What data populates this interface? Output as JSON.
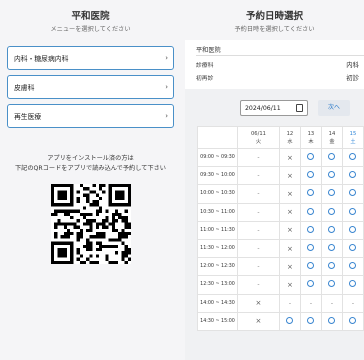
{
  "left": {
    "title": "平和医院",
    "subtitle": "メニューを選択してください",
    "menu": [
      {
        "label": "内科・糖尿病内科",
        "icon": "chevron-right-icon"
      },
      {
        "label": "皮膚科",
        "icon": "chevron-right-icon"
      },
      {
        "label": "再生医療",
        "icon": "chevron-right-icon"
      }
    ],
    "install_line1": "アプリをインストール済の方は",
    "install_line2": "下記のQRコードをアプリで読み込んで予約して下さい"
  },
  "right": {
    "title": "予約日時選択",
    "subtitle": "予約日時を選択してください",
    "clinic": "平和医院",
    "dept_label": "診療科",
    "dept_value": "内科",
    "visit_label": "初再診",
    "visit_value": "初診",
    "date_value": "2024/06/11",
    "next_label": "次へ",
    "days": [
      {
        "date": "06/11",
        "dow": "火"
      },
      {
        "date": "12",
        "dow": "水"
      },
      {
        "date": "13",
        "dow": "木"
      },
      {
        "date": "14",
        "dow": "金"
      },
      {
        "date": "15",
        "dow": "土"
      }
    ],
    "slots": [
      {
        "time": "09:00 ~ 09:30",
        "s": [
          "-",
          "x",
          "o",
          "o",
          "o"
        ]
      },
      {
        "time": "09:30 ~ 10:00",
        "s": [
          "-",
          "x",
          "o",
          "o",
          "o"
        ]
      },
      {
        "time": "10:00 ~ 10:30",
        "s": [
          "-",
          "x",
          "o",
          "o",
          "o"
        ]
      },
      {
        "time": "10:30 ~ 11:00",
        "s": [
          "-",
          "x",
          "o",
          "o",
          "o"
        ]
      },
      {
        "time": "11:00 ~ 11:30",
        "s": [
          "-",
          "x",
          "o",
          "o",
          "o"
        ]
      },
      {
        "time": "11:30 ~ 12:00",
        "s": [
          "-",
          "x",
          "o",
          "o",
          "o"
        ]
      },
      {
        "time": "12:00 ~ 12:30",
        "s": [
          "-",
          "x",
          "o",
          "o",
          "o"
        ]
      },
      {
        "time": "12:30 ~ 13:00",
        "s": [
          "-",
          "x",
          "o",
          "o",
          "o"
        ]
      },
      {
        "time": "14:00 ~ 14:30",
        "s": [
          "x",
          "-",
          "-",
          "-",
          "-"
        ]
      },
      {
        "time": "14:30 ~ 15:00",
        "s": [
          "x",
          "o",
          "o",
          "o",
          "o"
        ]
      }
    ]
  }
}
